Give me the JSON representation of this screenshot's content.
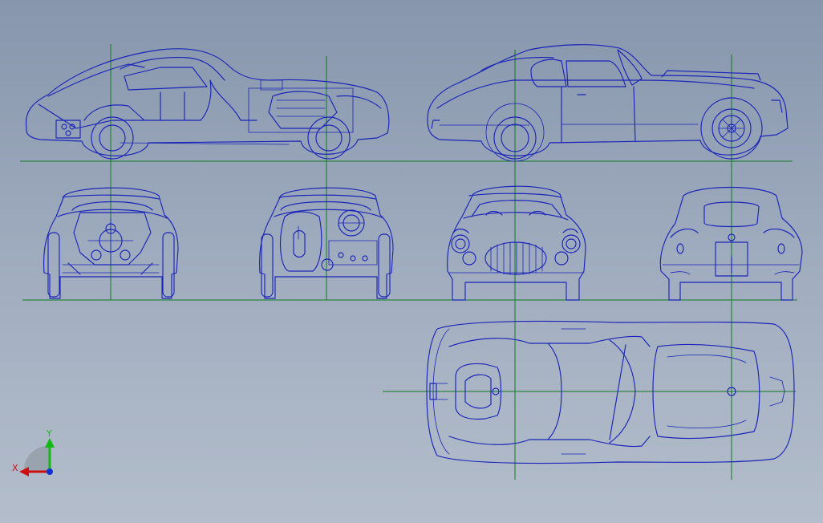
{
  "triad": {
    "x_label": "X",
    "y_label": "Y",
    "x_color": "#d01010",
    "y_color": "#14b814",
    "origin_color": "#1030d0"
  },
  "colors": {
    "background_top": "#8796ad",
    "background_bottom": "#b3bdcb",
    "drawing_lines": "#1a24b8",
    "guide_lines": "#0f7a1f"
  },
  "views": [
    "side-section-view",
    "side-exterior-view",
    "front-section-view",
    "rear-section-view",
    "front-exterior-view",
    "rear-exterior-view",
    "top-view"
  ]
}
